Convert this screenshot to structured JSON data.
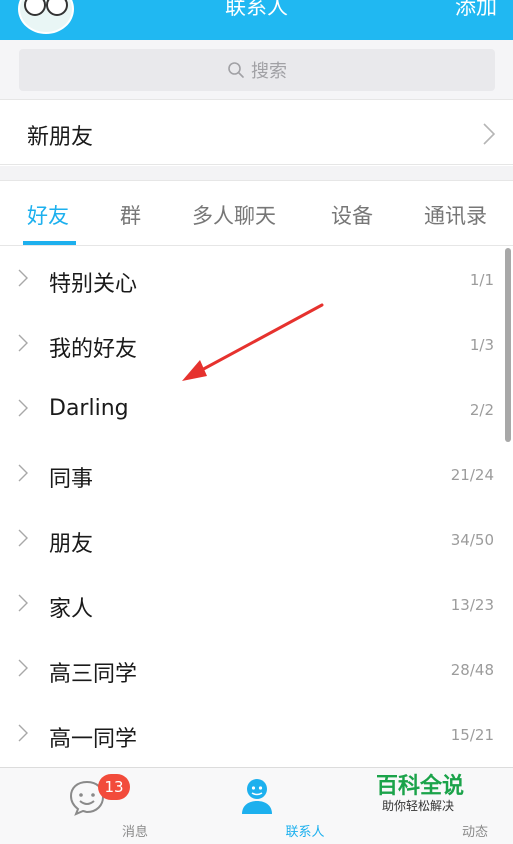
{
  "header": {
    "title": "联系人",
    "add_label": "添加"
  },
  "search": {
    "placeholder": "搜索"
  },
  "new_friends": {
    "label": "新朋友"
  },
  "tabs": [
    {
      "label": "好友",
      "active": true
    },
    {
      "label": "群",
      "active": false
    },
    {
      "label": "多人聊天",
      "active": false
    },
    {
      "label": "设备",
      "active": false
    },
    {
      "label": "通讯录",
      "active": false
    }
  ],
  "groups": [
    {
      "name": "特别关心",
      "count": "1/1"
    },
    {
      "name": "我的好友",
      "count": "1/3"
    },
    {
      "name": "Darling",
      "count": "2/2"
    },
    {
      "name": "同事",
      "count": "21/24"
    },
    {
      "name": "朋友",
      "count": "34/50"
    },
    {
      "name": "家人",
      "count": "13/23"
    },
    {
      "name": "高三同学",
      "count": "28/48"
    },
    {
      "name": "高一同学",
      "count": "15/21"
    }
  ],
  "bottom_nav": {
    "messages": {
      "label": "消息",
      "badge": "13"
    },
    "contacts": {
      "label": "联系人"
    },
    "dynamic": {
      "label": "动态"
    }
  },
  "watermark": {
    "title": "百科全说",
    "subtitle": "助你轻松解决"
  },
  "colors": {
    "accent": "#1db0ee",
    "header": "#20b8f2",
    "badge": "#f24b3b",
    "annotation_arrow": "#e6322e",
    "watermark": "#1ba34a"
  },
  "icons": [
    "avatar",
    "search-icon",
    "chevron-right-icon",
    "messages-icon",
    "contacts-icon"
  ]
}
